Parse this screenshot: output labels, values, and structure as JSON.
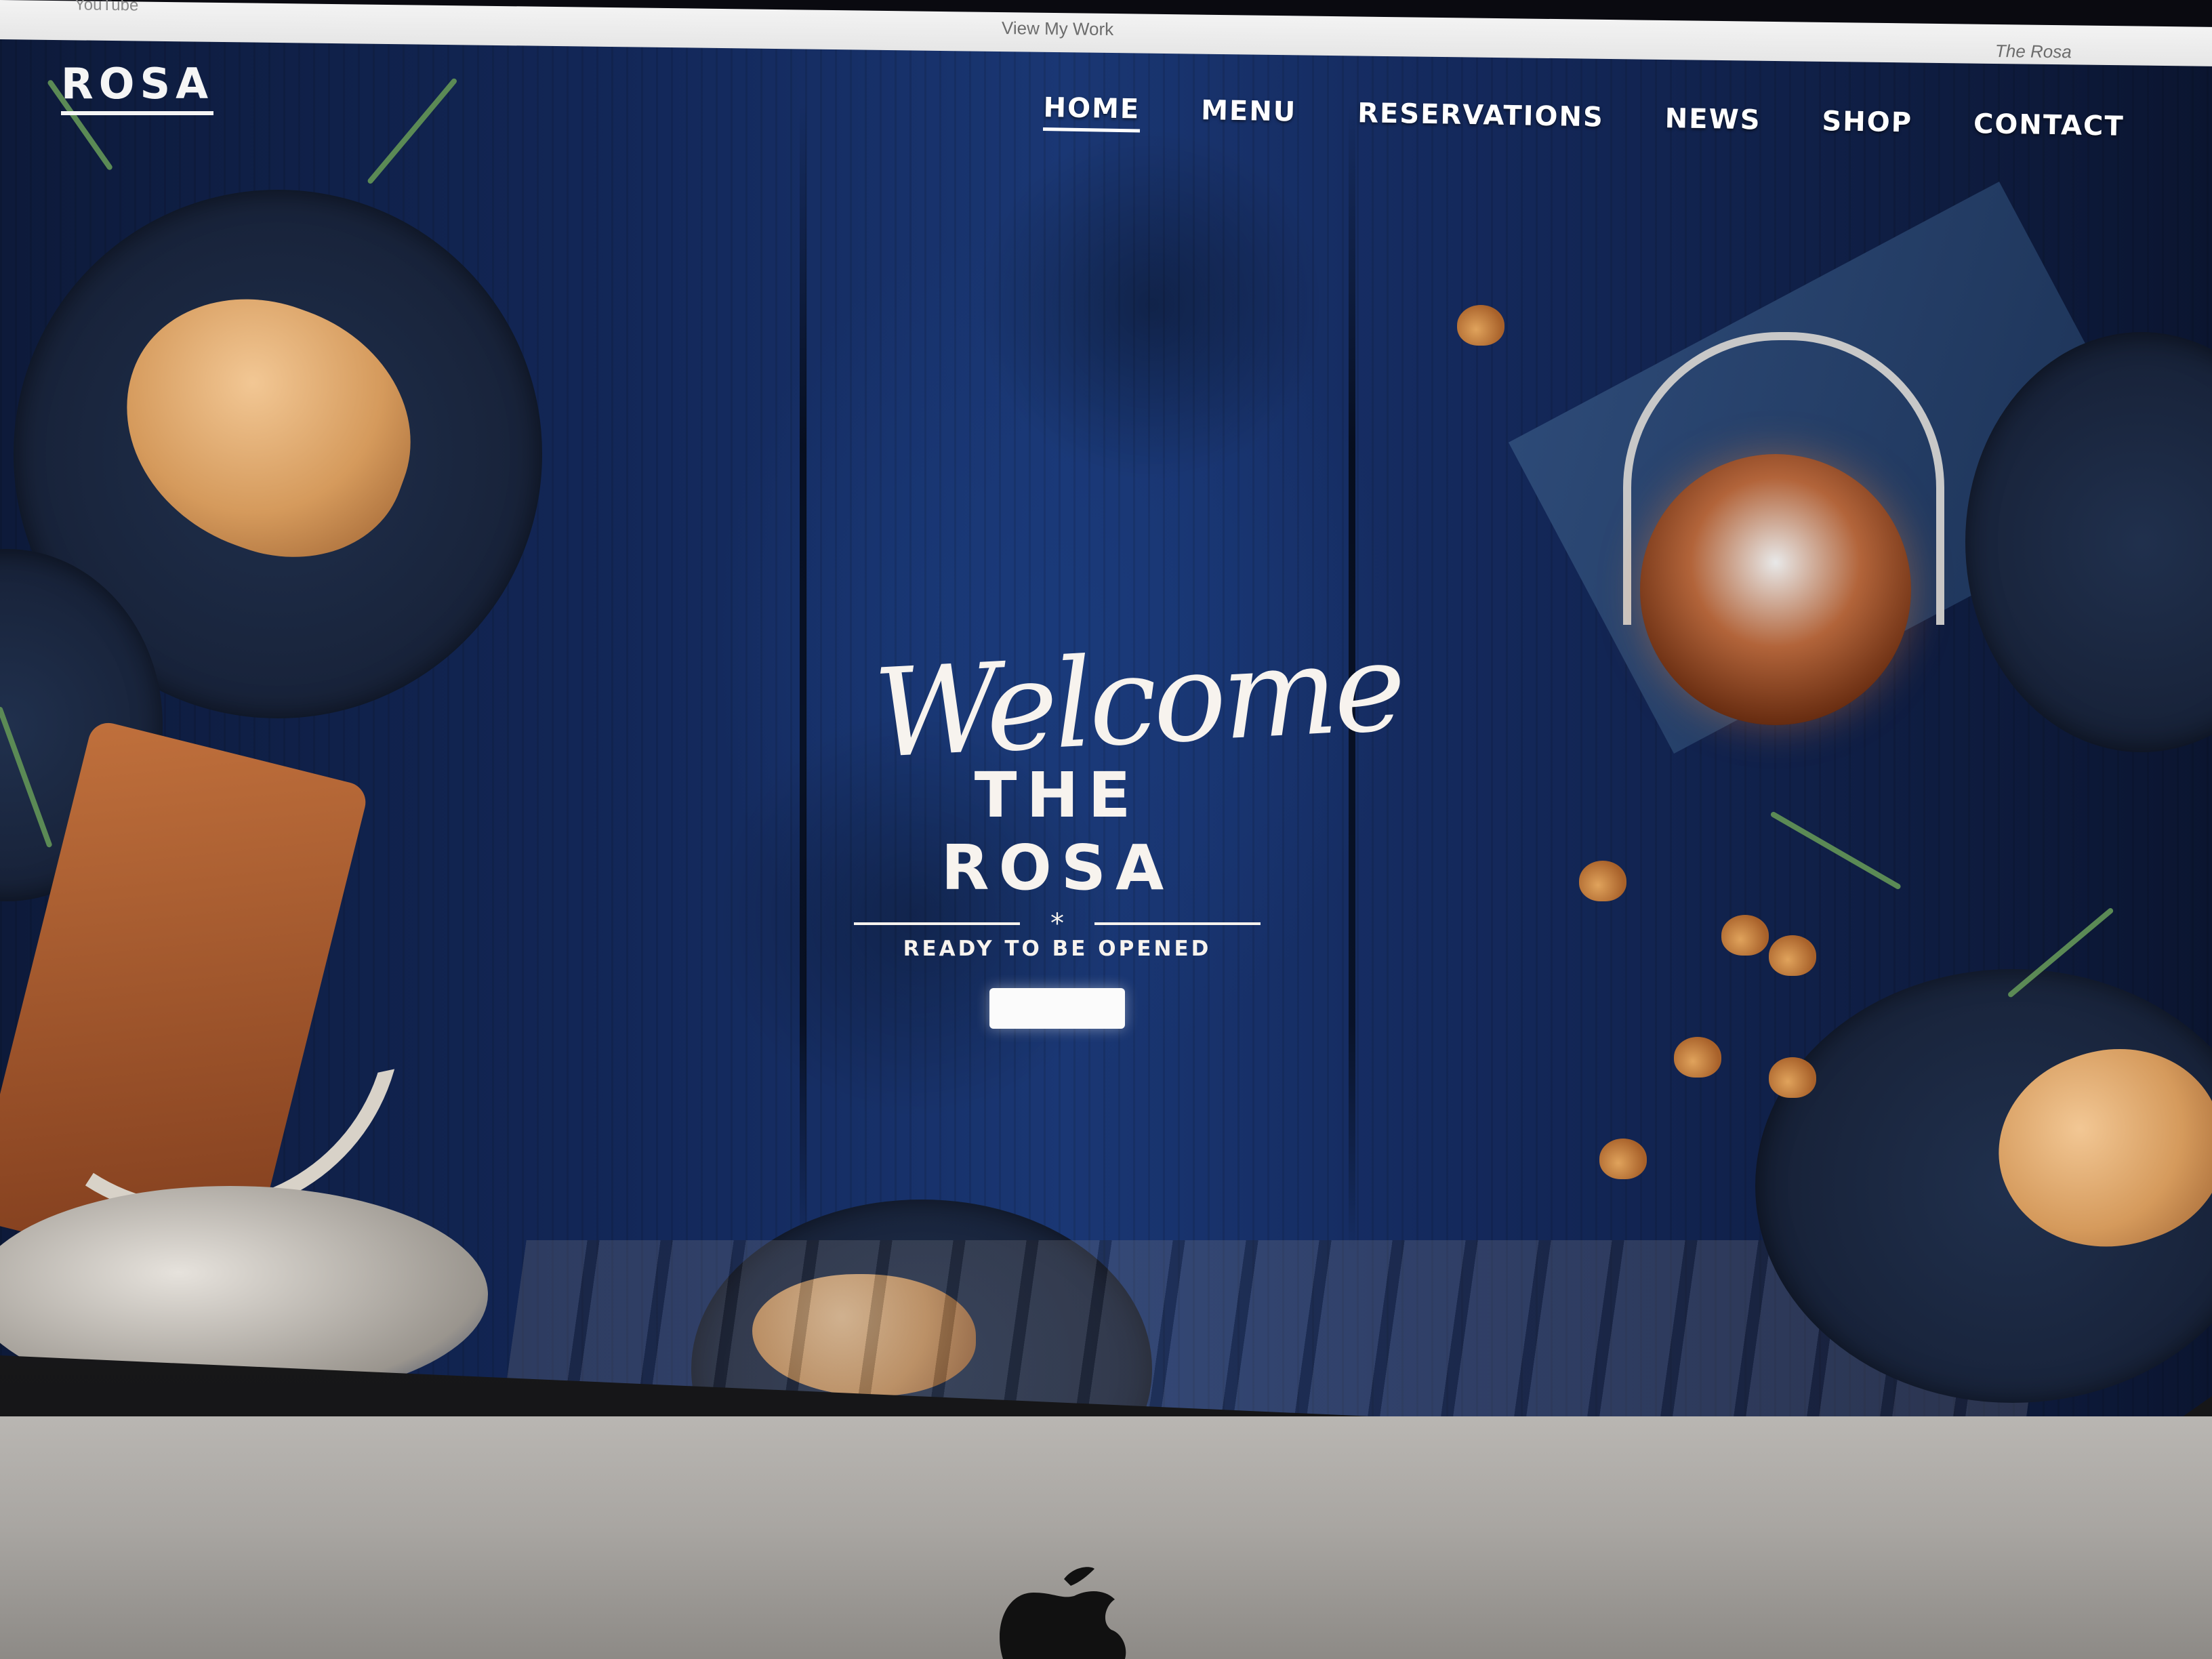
{
  "browser": {
    "tabs": [
      {
        "label": "YouTube"
      },
      {
        "label": "View My Work"
      },
      {
        "label": "The Rosa"
      }
    ]
  },
  "site": {
    "logo": "ROSA",
    "nav": [
      {
        "label": "HOME",
        "active": true
      },
      {
        "label": "MENU",
        "active": false
      },
      {
        "label": "RESERVATIONS",
        "active": false
      },
      {
        "label": "NEWS",
        "active": false
      },
      {
        "label": "SHOP",
        "active": false
      },
      {
        "label": "CONTACT",
        "active": false
      }
    ],
    "hero": {
      "script_title": "Welcome",
      "title": "THE ROSA",
      "divider_glyph": "*",
      "subtitle": "READY TO BE OPENED",
      "cta_label": ""
    }
  },
  "colors": {
    "background_blue": "#13285a",
    "text_light": "#f7f3ee",
    "browser_bar": "#ececec"
  }
}
